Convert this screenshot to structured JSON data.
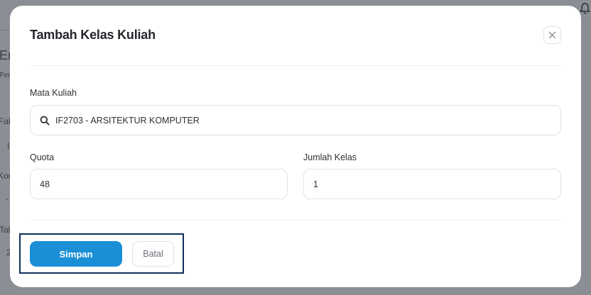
{
  "background": {
    "fragments": [
      "En",
      "Per",
      "Fak",
      "I",
      "Kon",
      "-",
      "Tah",
      "2"
    ]
  },
  "modal": {
    "title": "Tambah Kelas Kuliah",
    "close_icon": "close-icon",
    "mata_kuliah": {
      "label": "Mata Kuliah",
      "value": "IF2703 - ARSITEKTUR KOMPUTER",
      "icon": "search-icon"
    },
    "quota": {
      "label": "Quota",
      "value": "48"
    },
    "jumlah_kelas": {
      "label": "Jumlah Kelas",
      "value": "1"
    },
    "buttons": {
      "save": "Simpan",
      "cancel": "Batal"
    }
  },
  "colors": {
    "primary": "#1a8fd6",
    "focus_outline": "#0f2f5a",
    "overlay": "#8b8e94"
  }
}
